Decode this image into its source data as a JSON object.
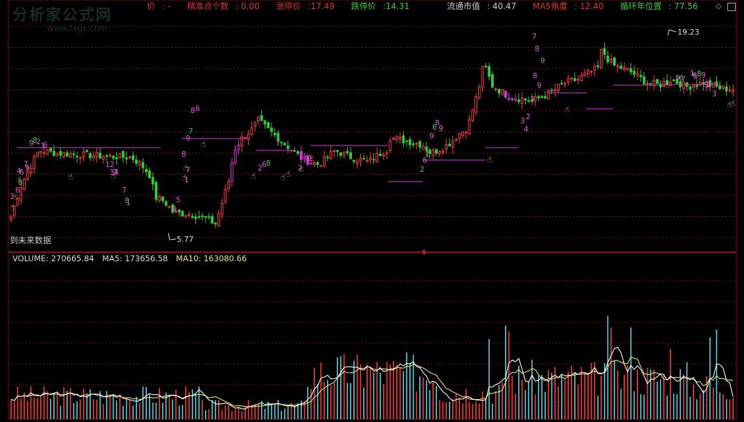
{
  "header": {
    "items": [
      {
        "label": "价",
        "value": "-",
        "color": "#e03030"
      },
      {
        "label": "精准点个数",
        "value": "0.00",
        "color": "#e03030"
      },
      {
        "label": "涨停价",
        "value": "17.49",
        "color": "#e03030"
      },
      {
        "label": "跌停价",
        "value": "14.31",
        "color": "#33cc33"
      },
      {
        "label": "流通市值",
        "value": "40.47",
        "color": "#cccccc"
      },
      {
        "label": "MA5角度",
        "value": "12.40",
        "color": "#e03030"
      },
      {
        "label": "循环年位置",
        "value": "77.56",
        "color": "#33cc33"
      }
    ]
  },
  "watermark": {
    "line1": "分析家公式网",
    "line2": "www.fxgs.com"
  },
  "note": "到未来数据",
  "corner_icons": [
    "diamond-icon",
    "square-icon"
  ],
  "volume_header": {
    "volume": "VOLUME: 270665.84",
    "ma5": "MA5: 173656.58",
    "ma10": "MA10: 163080.66"
  },
  "colors": {
    "up": "#ff3b3b",
    "down": "#33cc33",
    "signal": "#dd33dd",
    "vol_up": "#ff3b3b",
    "vol_down": "#54d6e8",
    "ma5": "#ffffff",
    "ma10": "#e8e86a",
    "separator": "#cc1111",
    "hand": "#f6c36a"
  },
  "chart_data": [
    {
      "type": "candlestick",
      "title": "",
      "ylim": [
        4.5,
        21.0
      ],
      "price_labels": [
        {
          "text": "19.23",
          "kind": "high"
        },
        {
          "text": "5.77",
          "kind": "low"
        }
      ],
      "highlight_index": 150,
      "highlight_text": "$",
      "markers": [
        "7",
        "8",
        "9",
        "8",
        "9",
        "8",
        "6",
        "9",
        "7",
        "8",
        "12",
        "34",
        "3",
        "7",
        "8",
        "1",
        "4",
        "5",
        "1",
        "7",
        "6",
        "8",
        "9",
        "9",
        "6",
        "1",
        "2",
        "3",
        "4",
        "2",
        "3",
        "6",
        "8",
        "9",
        "3",
        "2",
        "3",
        "5",
        "6",
        "7",
        "9",
        "1",
        "2",
        "6",
        "8",
        "9",
        "1",
        "2",
        "3",
        "6",
        "8",
        "9",
        "4",
        "6",
        "7",
        "9",
        "8",
        "2",
        "3",
        "6"
      ]
    },
    {
      "type": "bar",
      "title": "",
      "series": [
        {
          "name": "VOLUME",
          "last": 270665.84
        },
        {
          "name": "MA5",
          "last": 173656.58
        },
        {
          "name": "MA10",
          "last": 163080.66
        }
      ],
      "ylim": [
        0,
        760000
      ]
    }
  ]
}
